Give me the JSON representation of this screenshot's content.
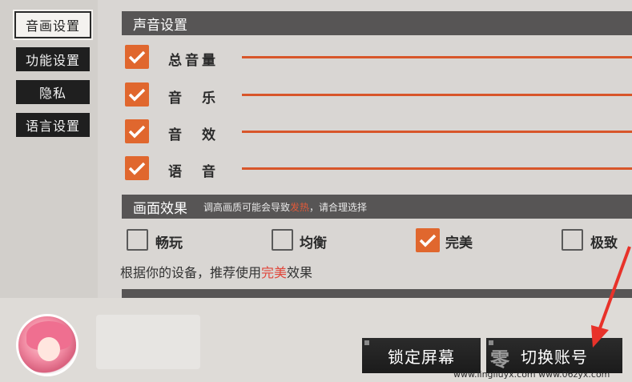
{
  "sidebar": {
    "items": [
      {
        "label": "音画设置",
        "active": true
      },
      {
        "label": "功能设置",
        "active": false
      },
      {
        "label": "隐私",
        "active": false
      },
      {
        "label": "语言设置",
        "active": false
      }
    ]
  },
  "sound": {
    "header": "声音设置",
    "rows": [
      {
        "label": "总音量",
        "checked": true
      },
      {
        "label": "音　乐",
        "checked": true
      },
      {
        "label": "音　效",
        "checked": true
      },
      {
        "label": "语　音",
        "checked": true
      }
    ]
  },
  "graphics": {
    "header": "画面效果",
    "note_prefix": "调高画质可能会导致",
    "note_warn": "发热",
    "note_suffix": "，请合理选择",
    "options": [
      {
        "label": "畅玩",
        "checked": false
      },
      {
        "label": "均衡",
        "checked": false
      },
      {
        "label": "完美",
        "checked": true
      },
      {
        "label": "极致",
        "checked": false
      }
    ],
    "recommend_prefix": "根据你的设备，推荐使用",
    "recommend_highlight": "完美",
    "recommend_suffix": "效果"
  },
  "bottom": {
    "lock_screen": "锁定屏幕",
    "switch_account": "切换账号"
  },
  "watermark": {
    "text": "www.lingliuyx.com  www.06zyx.com",
    "logo": "零"
  },
  "colors": {
    "accent": "#e0672e",
    "header_bg": "#575555",
    "annotation_arrow": "#e8322a"
  }
}
